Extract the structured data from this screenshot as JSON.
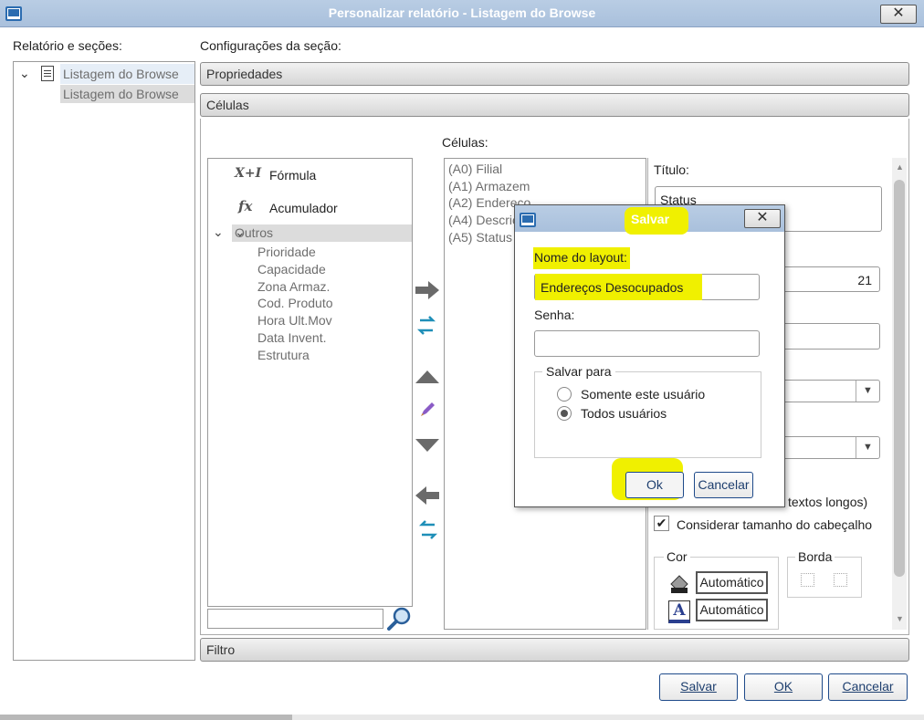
{
  "window": {
    "title": "Personalizar relatório - Listagem do Browse"
  },
  "left": {
    "heading": "Relatório e seções:",
    "tree": {
      "root": "Listagem do Browse",
      "child": "Listagem do Browse"
    }
  },
  "config": {
    "heading": "Configurações da seção:",
    "sections": {
      "propriedades": "Propriedades",
      "celulas": "Células",
      "filtro": "Filtro"
    }
  },
  "palette": {
    "formula": "Fórmula",
    "acumulador": "Acumulador",
    "outros": "Outros",
    "items": [
      "Prioridade",
      "Capacidade",
      "Zona Armaz.",
      "Cod. Produto",
      "Hora Ult.Mov",
      "Data Invent.",
      "Estrutura"
    ]
  },
  "cells": {
    "heading": "Células:",
    "items": [
      "(A0) Filial",
      "(A1) Armazem",
      "(A2) Endereco",
      "(A4) Descric",
      "(A5) Status"
    ]
  },
  "props": {
    "titulo_label": "Título:",
    "titulo_value": "Status",
    "tamanho_value": "21",
    "textos_longos": "textos longos)",
    "considerar": "Considerar tamanho do cabeçalho",
    "cor_label": "Cor",
    "borda_label": "Borda",
    "cor_fundo": "Automático",
    "cor_fonte": "Automático"
  },
  "dialog": {
    "title": "Salvar",
    "nome_label": "Nome do layout:",
    "nome_value": "Endereços Desocupados",
    "senha_label": "Senha:",
    "salvar_para": "Salvar para",
    "opt1": "Somente este usuário",
    "opt2": "Todos usuários",
    "ok": "Ok",
    "cancelar": "Cancelar"
  },
  "footer": {
    "salvar": "Salvar",
    "ok": "OK",
    "cancelar": "Cancelar"
  },
  "colors": {
    "highlight": "#f0f000",
    "titlebar": "#aec4df",
    "accent": "#1e4a8a"
  }
}
